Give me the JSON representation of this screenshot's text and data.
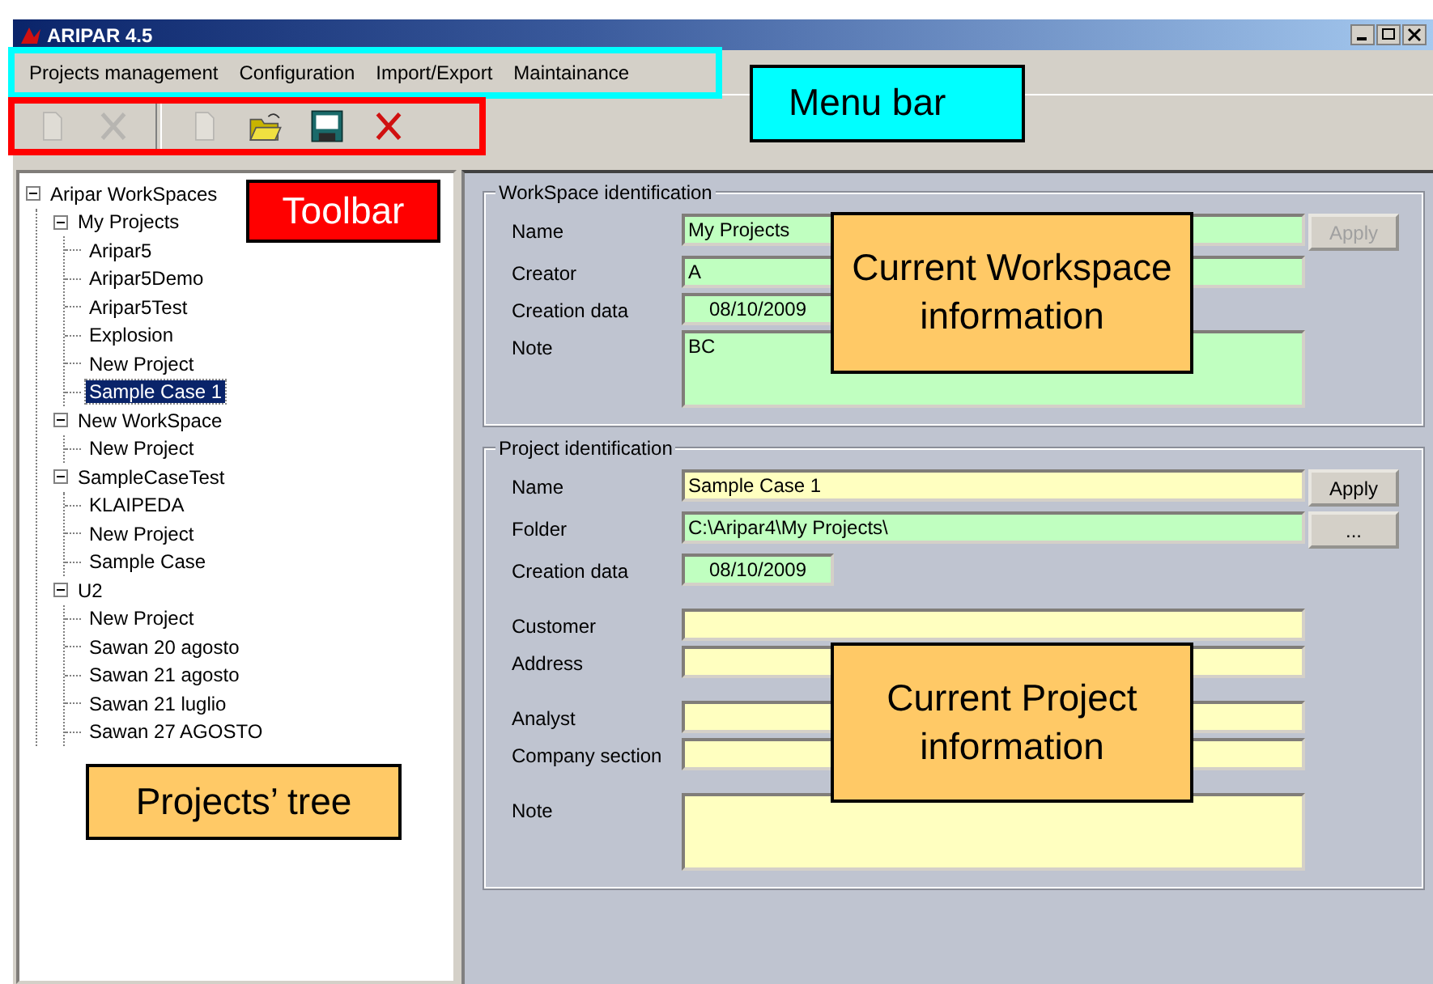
{
  "window": {
    "title": "ARIPAR 4.5"
  },
  "menu": [
    "Projects management",
    "Configuration",
    "Import/Export",
    "Maintainance"
  ],
  "toolbar": [
    {
      "kind": "doc",
      "disabled": true
    },
    {
      "kind": "cut",
      "disabled": true
    },
    {
      "kind": "separator"
    },
    {
      "kind": "new",
      "disabled": true
    },
    {
      "kind": "open",
      "disabled": false
    },
    {
      "kind": "save",
      "disabled": false
    },
    {
      "kind": "delete",
      "disabled": false
    }
  ],
  "tree": [
    {
      "label": "Aripar WorkSpaces",
      "selected": false,
      "expanded": true,
      "children": [
        {
          "label": "My Projects",
          "selected": false,
          "expanded": true,
          "children": [
            {
              "label": "Aripar5",
              "selected": false
            },
            {
              "label": "Aripar5Demo",
              "selected": false
            },
            {
              "label": "Aripar5Test",
              "selected": false
            },
            {
              "label": "Explosion",
              "selected": false
            },
            {
              "label": "New Project",
              "selected": false
            },
            {
              "label": "Sample Case 1",
              "selected": true
            }
          ]
        },
        {
          "label": "New WorkSpace",
          "selected": false,
          "expanded": true,
          "children": [
            {
              "label": "New Project",
              "selected": false
            }
          ]
        },
        {
          "label": "SampleCaseTest",
          "selected": false,
          "expanded": true,
          "children": [
            {
              "label": "KLAIPEDA",
              "selected": false
            },
            {
              "label": "New Project",
              "selected": false
            },
            {
              "label": "Sample Case",
              "selected": false
            }
          ]
        },
        {
          "label": "U2",
          "selected": false,
          "expanded": true,
          "children": [
            {
              "label": "New Project",
              "selected": false
            },
            {
              "label": "Sawan 20 agosto",
              "selected": false
            },
            {
              "label": "Sawan 21 agosto",
              "selected": false
            },
            {
              "label": "Sawan 21 luglio",
              "selected": false
            },
            {
              "label": "Sawan 27 AGOSTO",
              "selected": false
            }
          ]
        }
      ]
    }
  ],
  "groups": [
    {
      "legend": "WorkSpace identification",
      "field_groups": [
        [
          {
            "label": "Name",
            "kind": "text",
            "value": "My Projects",
            "color": "#c0ffc0",
            "button": {
              "label": "Apply",
              "disabled": true
            }
          },
          {
            "label": "Creator",
            "kind": "text",
            "value": "A",
            "color": "#c0ffc0"
          },
          {
            "label": "Creation data",
            "kind": "date",
            "value": "08/10/2009",
            "color": "#c0ffc0"
          },
          {
            "label": "Note",
            "kind": "note",
            "value": "BC",
            "color": "#c0ffc0"
          }
        ]
      ]
    },
    {
      "legend": "Project identification",
      "field_groups": [
        [
          {
            "label": "Name",
            "kind": "text",
            "value": "Sample Case 1",
            "color": "#ffffc0",
            "button": {
              "label": "Apply",
              "disabled": false
            }
          },
          {
            "label": "Folder",
            "kind": "text",
            "value": "C:\\Aripar4\\My Projects\\",
            "color": "#c0ffc0",
            "button": {
              "label": "...",
              "disabled": false
            }
          },
          {
            "label": "Creation data",
            "kind": "date",
            "value": "08/10/2009",
            "color": "#c0ffc0"
          }
        ],
        [
          {
            "label": "Customer",
            "kind": "text",
            "color": "#ffffc0"
          },
          {
            "label": "Address",
            "kind": "text",
            "color": "#ffffc0"
          }
        ],
        [
          {
            "label": "Analyst",
            "kind": "text",
            "color": "#ffffc0"
          },
          {
            "label": "Company section",
            "kind": "text",
            "color": "#ffffc0"
          }
        ],
        [
          {
            "label": "Note",
            "kind": "note",
            "color": "#ffffc0"
          }
        ]
      ]
    }
  ],
  "highlights": [
    {
      "kind": "menu",
      "color": "#00ffff"
    },
    {
      "kind": "toolbar",
      "color": "#ff0000"
    }
  ],
  "callouts": [
    {
      "text": "Menu bar",
      "color": "#00ffff",
      "kind": "menu"
    },
    {
      "text": "Toolbar",
      "color": "#ff0000",
      "kind": "toolbar"
    },
    {
      "text": "Current Workspace information",
      "color": "#ffc966",
      "kind": "workspace"
    },
    {
      "text": "Current Project information",
      "color": "#ffc966",
      "kind": "project"
    },
    {
      "text": "Projects’ tree",
      "color": "#ffc966",
      "kind": "tree"
    }
  ]
}
